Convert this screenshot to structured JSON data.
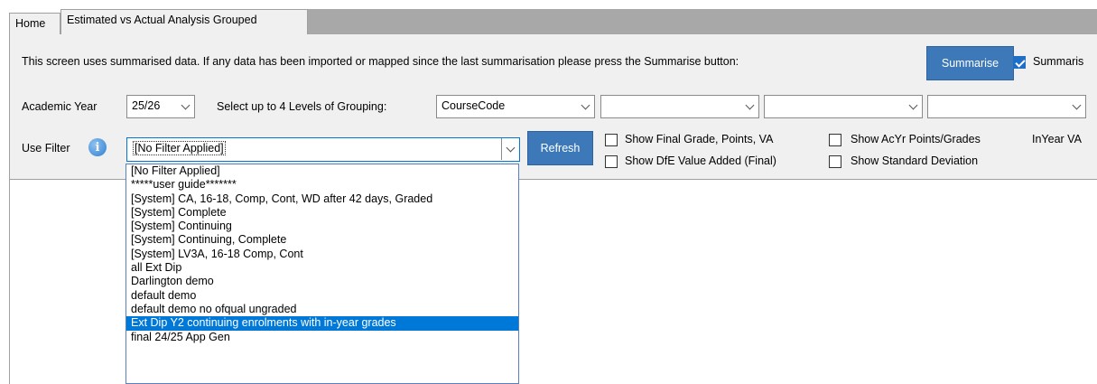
{
  "tabs": [
    {
      "label": "Home",
      "active": false
    },
    {
      "label": "Estimated vs Actual Analysis Grouped",
      "active": true
    }
  ],
  "info_bar": {
    "message": "This screen uses summarised data.  If any data has been imported or mapped since the last summarisation please press the Summarise button:",
    "summarise_button": "Summarise",
    "summarise_checkbox_label": "Summaris",
    "summarise_checked": true
  },
  "filters": {
    "academic_year_label": "Academic Year",
    "academic_year_value": "25/26",
    "grouping_label": "Select up to 4 Levels of Grouping:",
    "grouping_values": [
      "CourseCode",
      "",
      "",
      ""
    ],
    "use_filter_label": "Use Filter",
    "filter_value": "[No Filter Applied]",
    "refresh_button": "Refresh"
  },
  "options": {
    "show_final_grade": "Show Final Grade, Points, VA",
    "show_dfe_value_added": "Show DfE Value Added (Final)",
    "show_acyr_points": "Show AcYr Points/Grades",
    "show_std_dev": "Show Standard Deviation",
    "inyear_label": "InYear VA"
  },
  "filter_dropdown": {
    "items": [
      "[No Filter Applied]",
      "*****user guide*******",
      "[System]  CA, 16-18, Comp, Cont, WD after 42 days, Graded",
      "[System]  Complete",
      "[System]  Continuing",
      "[System]  Continuing, Complete",
      "[System]  LV3A, 16-18 Comp, Cont",
      "all Ext Dip",
      "Darlington demo",
      "default demo",
      "default demo no ofqual ungraded",
      "Ext Dip Y2 continuing enrolments with in-year grades",
      "final 24/25 App Gen"
    ],
    "selected_index": 11
  },
  "colors": {
    "accent_blue": "#3d79b8",
    "selection": "#0078d7",
    "tab_bar": "#a8a8a8",
    "panel_bg": "#f0f0f0"
  }
}
